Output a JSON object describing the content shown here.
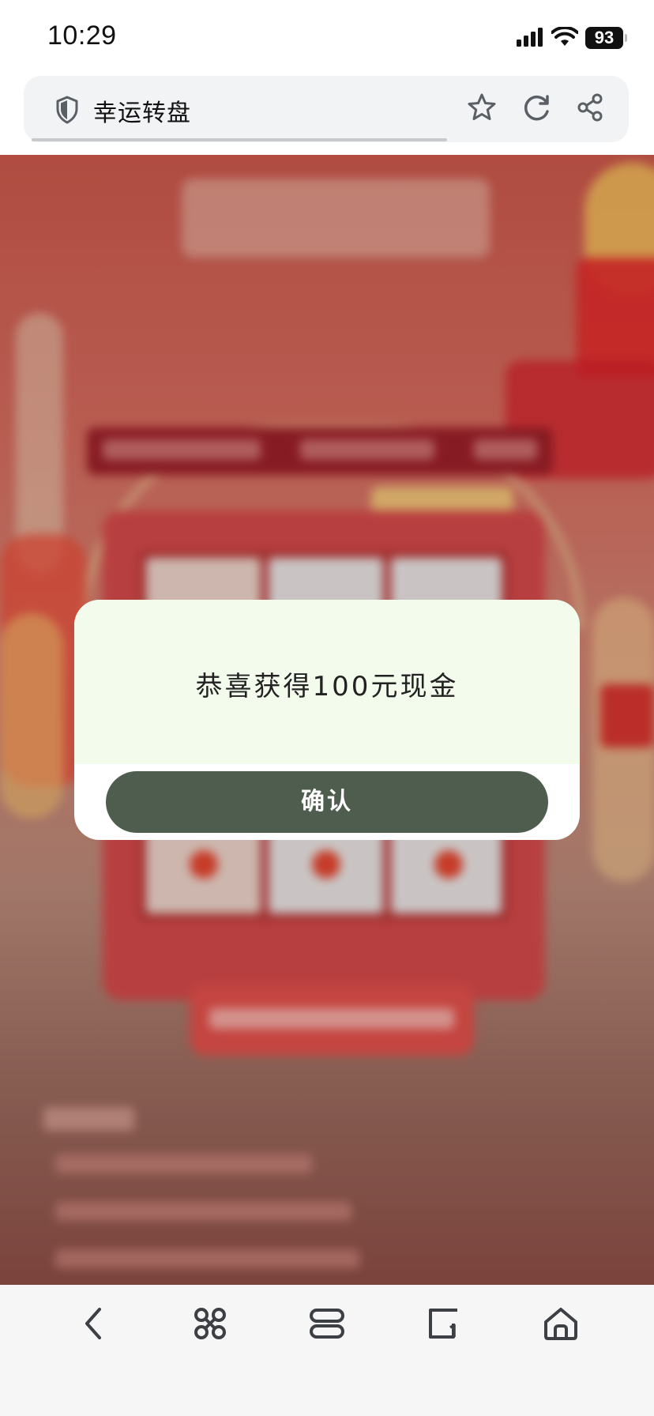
{
  "status_bar": {
    "time": "10:29",
    "battery": "93"
  },
  "address_bar": {
    "title": "幸运转盘"
  },
  "modal": {
    "message": "恭喜获得100元现金",
    "confirm_label": "确认"
  },
  "icons": {
    "security": "shield-icon",
    "favorite": "star-icon",
    "reload": "reload-icon",
    "share": "share-icon",
    "back": "back-icon",
    "menu": "command-icon",
    "tabs": "tabs-icon",
    "windows": "window-count-icon",
    "home": "home-icon"
  },
  "colors": {
    "confirm_button": "#4f5d4e",
    "modal_top": "#f3fbec",
    "page_bg": "#c9574b"
  }
}
